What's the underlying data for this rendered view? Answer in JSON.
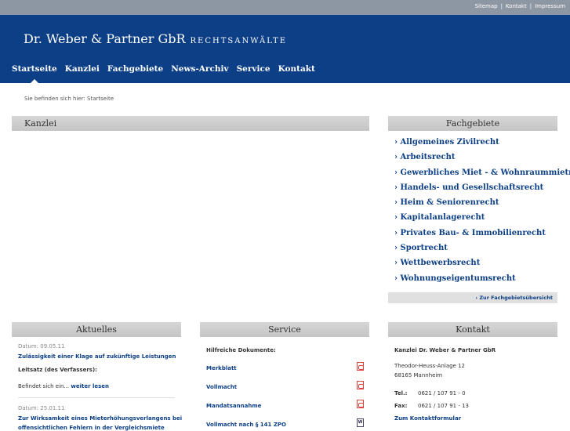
{
  "toplinks": [
    "Sitemap",
    "Kontakt",
    "Impressum"
  ],
  "brand": {
    "name": "Dr. Weber & Partner GbR",
    "sub": "RECHTSANWÄLTE"
  },
  "nav": [
    "Startseite",
    "Kanzlei",
    "Fachgebiete",
    "News-Archiv",
    "Service",
    "Kontakt"
  ],
  "breadcrumb": "Sie befinden sich hier: Startseite",
  "kanzlei": {
    "title": "Kanzlei"
  },
  "fachgebiete": {
    "title": "Fachgebiete",
    "items": [
      "› Allgemeines Zivilrecht",
      "› Arbeitsrecht",
      "› Gewerbliches Miet - & Wohnraummietrecht",
      "› Handels- und Gesellschaftsrecht",
      "› Heim & Seniorenrecht",
      "› Kapitalanlagerecht",
      "› Privates Bau- & Immobilienrecht",
      "› Sportrecht",
      "› Wettbewerbsrecht",
      "› Wohnungseigentumsrecht"
    ],
    "more": "› Zur Fachgebietsübersicht"
  },
  "aktuelles": {
    "title": "Aktuelles",
    "n1_date": "Datum: 09.05.11",
    "n1_title": "Zulässigkeit einer Klage auf zukünftige Leistungen",
    "n1_leit": "Leitsatz (des Verfassers):",
    "n1_text": "Befindet sich ein...",
    "n1_more": "weiter lesen",
    "n2_date": "Datum: 25.01.11",
    "n2_title_1": "Zur Wirksamkeit eines Mieterhöhungsverlangens bei",
    "n2_title_2": "offensichtlichen Fehlern in der Vergleichsmiete"
  },
  "service": {
    "title": "Service",
    "intro": "Hilfreiche Dokumente:",
    "docs": [
      {
        "label": "Merkblatt",
        "icon": "pdf-icon"
      },
      {
        "label": "Vollmacht",
        "icon": "pdf-icon"
      },
      {
        "label": "Mandatsannahme",
        "icon": "pdf-icon"
      },
      {
        "label": "Vollmacht nach § 141 ZPO",
        "icon": "word-icon"
      }
    ]
  },
  "kontakt": {
    "title": "Kontakt",
    "firm": "Kanzlei Dr. Weber & Partner GbR",
    "street": "Theodor-Heuss-Anlage 12",
    "city": "68165 Mannheim",
    "tel_label": "Tel.:",
    "tel": "0621 / 107 91 - 0",
    "fax_label": "Fax:",
    "fax": "0621 / 107 91 - 13",
    "form": "Zum Kontaktformular"
  },
  "colors": {
    "brand_blue": "#0c3f86",
    "topbar": "#8d96a3",
    "panel_header": "#cfcfcf"
  }
}
